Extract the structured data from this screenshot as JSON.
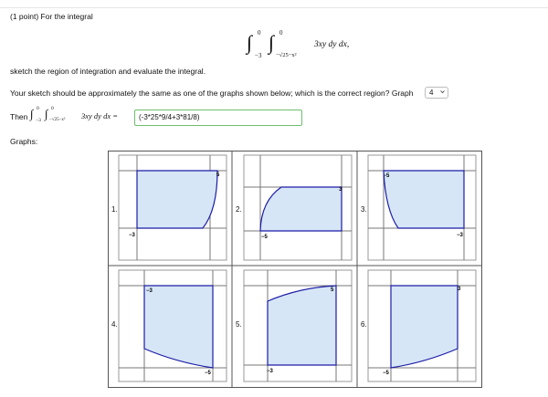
{
  "problem": {
    "header": "(1 point) For the integral",
    "integral_main": "3xy dy dx,",
    "outer_limits": {
      "lower": "−3",
      "upper": "0"
    },
    "inner_limits": {
      "lower": "−√25−x²",
      "upper": "0"
    },
    "instruction": "sketch the region of integration and evaluate the integral.",
    "question": "Your sketch should be approximately the same as one of the graphs shown below; which is the correct region? Graph",
    "selected_graph": "4",
    "then_label": "Then",
    "then_integrand": "3xy dy dx =",
    "answer_value": "(-3*25*9/4+3*81/8)",
    "graphs_label": "Graphs:"
  },
  "graphs": [
    {
      "label": "1.",
      "ticks": [
        "5",
        "−3"
      ]
    },
    {
      "label": "2.",
      "ticks": [
        "3",
        "−5"
      ]
    },
    {
      "label": "3.",
      "ticks": [
        "-5",
        "−3"
      ]
    },
    {
      "label": "4.",
      "ticks": [
        "−3",
        "−5"
      ]
    },
    {
      "label": "5.",
      "ticks": [
        "5",
        "−3"
      ]
    },
    {
      "label": "6.",
      "ticks": [
        "3",
        "−5"
      ]
    }
  ],
  "colors": {
    "region_fill": "#d6e6f6",
    "region_stroke": "#1c1ca8",
    "answer_border": "#6fbf6f"
  },
  "icons": {
    "dropdown": "chevron-down-icon"
  }
}
